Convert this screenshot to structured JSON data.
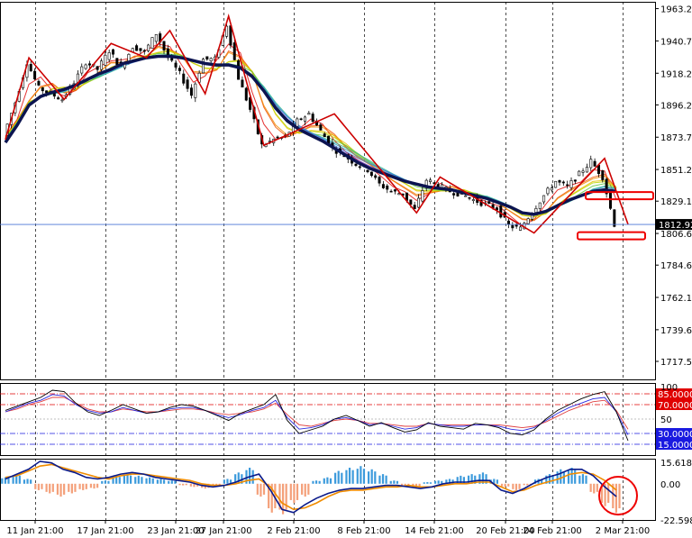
{
  "chart_data": [
    {
      "type": "candlestick",
      "panel": "price",
      "y_ticks": [
        "1963.25",
        "1940.75",
        "1918.25",
        "1896.20",
        "1873.70",
        "1851.20",
        "1829.15",
        "1806.65",
        "1784.60",
        "1762.10",
        "1739.60",
        "1717.55"
      ],
      "ylim": [
        1705,
        1968
      ],
      "current_price": "1812.92",
      "close_path": [
        {
          "x": "11 Jan 21:00",
          "y": 1875
        },
        {
          "x": "12 Jan",
          "y": 1898
        },
        {
          "x": "13 Jan",
          "y": 1926
        },
        {
          "x": "14 Jan",
          "y": 1908
        },
        {
          "x": "15 Jan",
          "y": 1904
        },
        {
          "x": "16 Jan",
          "y": 1900
        },
        {
          "x": "17 Jan 21:00",
          "y": 1912
        },
        {
          "x": "18 Jan",
          "y": 1926
        },
        {
          "x": "19 Jan",
          "y": 1921
        },
        {
          "x": "20 Jan",
          "y": 1934
        },
        {
          "x": "21 Jan",
          "y": 1922
        },
        {
          "x": "22 Jan",
          "y": 1937
        },
        {
          "x": "23 Jan 21:00",
          "y": 1933
        },
        {
          "x": "24 Jan",
          "y": 1946
        },
        {
          "x": "25 Jan",
          "y": 1929
        },
        {
          "x": "26 Jan",
          "y": 1918
        },
        {
          "x": "27 Jan 21:00",
          "y": 1903
        },
        {
          "x": "28 Jan",
          "y": 1928
        },
        {
          "x": "29 Jan",
          "y": 1928
        },
        {
          "x": "30 Jan",
          "y": 1952
        },
        {
          "x": "31 Jan",
          "y": 1915
        },
        {
          "x": "1 Feb",
          "y": 1893
        },
        {
          "x": "2 Feb 21:00",
          "y": 1868
        },
        {
          "x": "3 Feb",
          "y": 1872
        },
        {
          "x": "4 Feb",
          "y": 1874
        },
        {
          "x": "5 Feb",
          "y": 1885
        },
        {
          "x": "6 Feb",
          "y": 1890
        },
        {
          "x": "7 Feb",
          "y": 1878
        },
        {
          "x": "8 Feb 21:00",
          "y": 1866
        },
        {
          "x": "9 Feb",
          "y": 1861
        },
        {
          "x": "10 Feb",
          "y": 1855
        },
        {
          "x": "11 Feb",
          "y": 1851
        },
        {
          "x": "12 Feb",
          "y": 1841
        },
        {
          "x": "13 Feb",
          "y": 1836
        },
        {
          "x": "14 Feb 21:00",
          "y": 1834
        },
        {
          "x": "15 Feb",
          "y": 1823
        },
        {
          "x": "16 Feb",
          "y": 1844
        },
        {
          "x": "17 Feb",
          "y": 1840
        },
        {
          "x": "18 Feb",
          "y": 1836
        },
        {
          "x": "19 Feb",
          "y": 1834
        },
        {
          "x": "20 Feb 21:00",
          "y": 1830
        },
        {
          "x": "21 Feb",
          "y": 1827
        },
        {
          "x": "22 Feb",
          "y": 1824
        },
        {
          "x": "23 Feb",
          "y": 1812
        },
        {
          "x": "24 Feb 21:00",
          "y": 1810
        },
        {
          "x": "25 Feb",
          "y": 1822
        },
        {
          "x": "26 Feb",
          "y": 1833
        },
        {
          "x": "27 Feb",
          "y": 1843
        },
        {
          "x": "28 Feb",
          "y": 1839
        },
        {
          "x": "1 Mar",
          "y": 1848
        },
        {
          "x": "2 Mar 21:00",
          "y": 1857
        },
        {
          "x": "3 Mar",
          "y": 1846
        },
        {
          "x": "4 Mar",
          "y": 1813
        }
      ],
      "zigzag": [
        {
          "i": 0,
          "y": 1872
        },
        {
          "i": 2,
          "y": 1929
        },
        {
          "i": 5,
          "y": 1900
        },
        {
          "i": 9,
          "y": 1939
        },
        {
          "i": 12,
          "y": 1929
        },
        {
          "i": 14,
          "y": 1948
        },
        {
          "i": 17,
          "y": 1904
        },
        {
          "i": 19,
          "y": 1958
        },
        {
          "i": 22,
          "y": 1868
        },
        {
          "i": 28,
          "y": 1890
        },
        {
          "i": 35,
          "y": 1821
        },
        {
          "i": 37,
          "y": 1846
        },
        {
          "i": 45,
          "y": 1807
        },
        {
          "i": 51,
          "y": 1859
        },
        {
          "i": 53,
          "y": 1813
        }
      ],
      "slow_ma": [
        1870,
        1882,
        1896,
        1902,
        1905,
        1907,
        1910,
        1914,
        1918,
        1921,
        1925,
        1927,
        1929,
        1930,
        1930,
        1929,
        1927,
        1925,
        1924,
        1924,
        1922,
        1916,
        1906,
        1894,
        1885,
        1879,
        1875,
        1871,
        1866,
        1861,
        1856,
        1852,
        1849,
        1846,
        1843,
        1841,
        1839,
        1838,
        1837,
        1835,
        1833,
        1831,
        1828,
        1825,
        1821,
        1820,
        1822,
        1826,
        1830,
        1833,
        1836,
        1837,
        1836
      ],
      "highlight_boxes": [
        {
          "label": "resistance-zone",
          "y_center": 1833
        },
        {
          "label": "target-zone",
          "y_center": 1805
        }
      ]
    },
    {
      "type": "line",
      "panel": "oscillator",
      "levels": [
        "85.0000",
        "70.0000",
        "30.0000",
        "15.0000"
      ],
      "ylim": [
        0,
        100
      ],
      "extra_tick": "50",
      "max_tick": "100",
      "black": [
        62,
        68,
        74,
        80,
        90,
        88,
        72,
        60,
        55,
        62,
        70,
        64,
        58,
        60,
        66,
        70,
        68,
        62,
        55,
        48,
        58,
        64,
        70,
        84,
        48,
        30,
        35,
        40,
        50,
        55,
        48,
        40,
        45,
        38,
        32,
        35,
        45,
        40,
        38,
        36,
        44,
        42,
        38,
        30,
        28,
        35,
        50,
        62,
        70,
        78,
        84,
        88,
        60,
        20
      ],
      "blue": [
        60,
        66,
        72,
        76,
        84,
        82,
        70,
        62,
        58,
        60,
        66,
        62,
        58,
        60,
        64,
        66,
        66,
        62,
        56,
        52,
        56,
        62,
        66,
        76,
        52,
        36,
        38,
        42,
        50,
        52,
        48,
        42,
        44,
        40,
        36,
        38,
        44,
        42,
        40,
        40,
        42,
        42,
        40,
        36,
        34,
        38,
        48,
        58,
        66,
        72,
        78,
        80,
        60,
        28
      ],
      "red": [
        60,
        64,
        70,
        74,
        80,
        80,
        72,
        64,
        60,
        60,
        64,
        62,
        60,
        60,
        62,
        64,
        64,
        62,
        58,
        56,
        58,
        60,
        64,
        72,
        56,
        42,
        40,
        44,
        48,
        50,
        48,
        44,
        44,
        42,
        40,
        40,
        44,
        42,
        42,
        42,
        42,
        42,
        42,
        40,
        38,
        40,
        46,
        54,
        62,
        68,
        74,
        76,
        62,
        36
      ]
    },
    {
      "type": "bar",
      "panel": "macd",
      "y_ticks": [
        "15.6181",
        "0.00",
        "-22.5988"
      ],
      "ylim": [
        -22.5988,
        15.6181
      ],
      "histogram": [
        4,
        6,
        3,
        -4,
        -6,
        -8,
        -6,
        -4,
        -3,
        2,
        5,
        6,
        5,
        4,
        3,
        2,
        -1,
        -2,
        -3,
        -1,
        3,
        7,
        10,
        -8,
        -18,
        -19,
        -12,
        -8,
        2,
        4,
        8,
        10,
        11,
        9,
        6,
        2,
        -2,
        -3,
        1,
        2,
        3,
        5,
        6,
        7,
        3,
        -2,
        -4,
        -1,
        3,
        6,
        9,
        10,
        6,
        -6,
        -14,
        -18
      ],
      "signal": [
        4,
        5,
        8,
        11,
        12,
        10,
        8,
        6,
        4,
        3,
        5,
        6,
        6,
        5,
        4,
        3,
        2,
        0,
        -1,
        -1,
        0,
        2,
        3,
        -2,
        -12,
        -16,
        -15,
        -12,
        -8,
        -5,
        -4,
        -4,
        -3,
        -2,
        -2,
        -1,
        -2,
        -2,
        -1,
        0,
        0,
        1,
        1,
        -2,
        -5,
        -4,
        -1,
        1,
        3,
        6,
        7,
        6,
        2,
        -4
      ],
      "main": [
        3,
        6,
        9,
        14,
        13,
        9,
        7,
        4,
        3,
        4,
        6,
        7,
        6,
        4,
        3,
        2,
        1,
        -1,
        -2,
        -1,
        1,
        4,
        6,
        -4,
        -16,
        -18,
        -13,
        -9,
        -6,
        -4,
        -3,
        -3,
        -2,
        -1,
        -1,
        -2,
        -3,
        -2,
        0,
        1,
        1,
        2,
        2,
        -4,
        -6,
        -3,
        1,
        4,
        6,
        9,
        9,
        5,
        -2,
        -8
      ]
    },
    {
      "type": "axis",
      "x_ticks": [
        "11 Jan 21:00",
        "17 Jan 21:00",
        "23 Jan 21:00",
        "27 Jan 21:00",
        "2 Feb 21:00",
        "8 Feb 21:00",
        "14 Feb 21:00",
        "20 Feb 21:00",
        "24 Feb 21:00",
        "2 Mar 21:00"
      ]
    }
  ],
  "colors": {
    "background": "#ffffff",
    "grid": "#808080",
    "candle": "#000000",
    "zigzag": "#cc0000",
    "slow_ma": "#0c1450",
    "current_line": "#4a74d6",
    "level_red": "#e00000",
    "level_blue": "#1a1ae0",
    "osc_black": "#000000",
    "osc_blue": "#2a2ae0",
    "osc_red": "#e04040",
    "hist_pos": "#3d9bdc",
    "hist_neg": "#f4a07a",
    "macd_main": "#0a1a8a",
    "macd_signal": "#f08c00",
    "highlight": "#ee0000"
  }
}
